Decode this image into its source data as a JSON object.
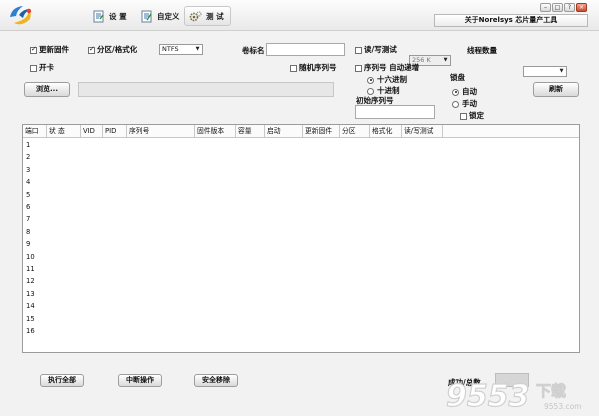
{
  "titlebar": {
    "tabs": [
      {
        "label": "设 置",
        "icon": "settings-doc-icon"
      },
      {
        "label": "自定义",
        "icon": "edit-doc-icon"
      },
      {
        "label": "测 试",
        "icon": "gear-test-icon"
      }
    ],
    "about_label": "关于Norelsys 芯片量产工具",
    "window_controls": [
      "minimize",
      "restore",
      "help",
      "close"
    ]
  },
  "options": {
    "update_firmware": {
      "label": "更新固件",
      "checked": true
    },
    "partition_format": {
      "label": "分区/格式化",
      "checked": true
    },
    "filesystem": {
      "value": "NTFS"
    },
    "volume_label": {
      "label": "卷标名",
      "value": ""
    },
    "rw_test": {
      "label": "读/写测试",
      "checked": false
    },
    "rw_size": {
      "value": "256 K"
    },
    "thread_count": {
      "label": "线程数量",
      "value": ""
    },
    "open_card": {
      "label": "开卡",
      "checked": false
    },
    "random_serial": {
      "label": "随机序列号",
      "checked": false
    },
    "serial_auto_inc": {
      "label": "序列号 自动递增",
      "checked": false
    },
    "hex": {
      "label": "十六进制",
      "selected": true
    },
    "dec": {
      "label": "十进制",
      "selected": false
    },
    "initial_serial": {
      "label": "初始序列号",
      "value": ""
    },
    "lock_group": {
      "title": "锁盘",
      "auto": {
        "label": "自动",
        "selected": true
      },
      "manual": {
        "label": "手动",
        "selected": false
      },
      "lock": {
        "label": "锁定",
        "checked": false
      }
    }
  },
  "browse": {
    "label": "浏览...",
    "path": ""
  },
  "refresh_label": "刷新",
  "grid": {
    "columns": [
      "端口",
      "状 态",
      "VID",
      "PID",
      "序列号",
      "固件版本",
      "容量",
      "启动",
      "更新固件",
      "分区",
      "格式化",
      "读/写测试"
    ],
    "rows": [
      "1",
      "2",
      "3",
      "4",
      "5",
      "6",
      "7",
      "8",
      "9",
      "10",
      "11",
      "12",
      "13",
      "14",
      "15",
      "16"
    ]
  },
  "actions": {
    "run_all": "执行全部",
    "abort": "中断操作",
    "safe_remove": "安全移除"
  },
  "result": {
    "label": "成功/总数",
    "value": ""
  },
  "watermark": {
    "text": "9553",
    "subtext": "下载",
    "domain": "9553.com"
  }
}
